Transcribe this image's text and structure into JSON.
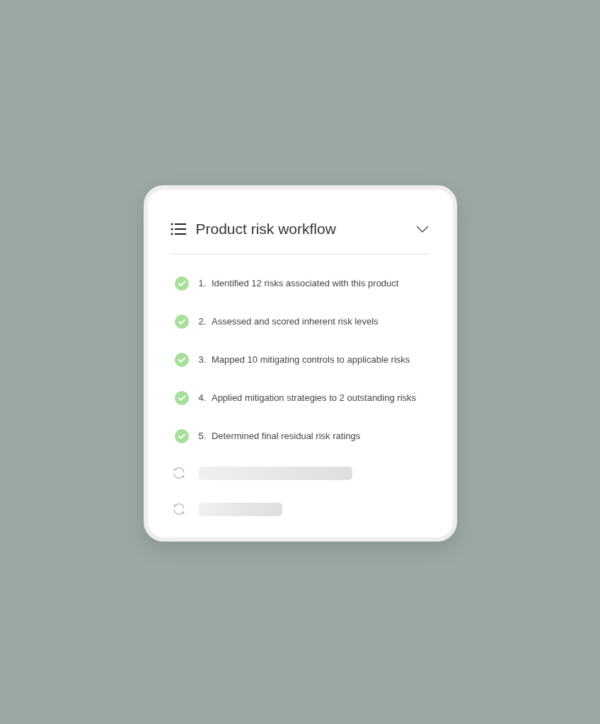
{
  "card": {
    "title": "Product risk workflow",
    "steps": [
      {
        "kind": "done",
        "number": "1.",
        "text": "Identified 12 risks associated with this product"
      },
      {
        "kind": "done",
        "number": "2.",
        "text": "Assessed and scored inherent risk levels"
      },
      {
        "kind": "done",
        "number": "3.",
        "text": "Mapped 10 mitigating controls to applicable risks"
      },
      {
        "kind": "done",
        "number": "4.",
        "text": "Applied mitigation strategies to 2 outstanding risks"
      },
      {
        "kind": "done",
        "number": "5.",
        "text": "Determined final residual risk ratings"
      },
      {
        "kind": "pending"
      },
      {
        "kind": "pending"
      }
    ]
  }
}
